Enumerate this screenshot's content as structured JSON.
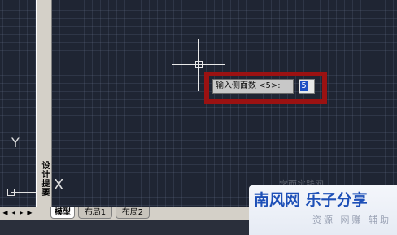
{
  "palette": {
    "title": "设计提要",
    "icon": "palette-menu-icon"
  },
  "prompt": {
    "text": "输入侧面数 <5>:",
    "value": "5"
  },
  "ucs": {
    "y_label": "Y",
    "x_label": "X"
  },
  "tabs": {
    "nav_first": "◀",
    "nav_prev": "◂",
    "nav_next": "▸",
    "nav_last": "▶",
    "items": [
      {
        "label": "模型",
        "active": true
      },
      {
        "label": "布局1",
        "active": false
      },
      {
        "label": "布局2",
        "active": false
      }
    ]
  },
  "watermark": {
    "main": "南风网 乐子分享",
    "sub": "资源 网赚 辅助",
    "faint": "学而实践网"
  },
  "colors": {
    "canvas": "#1f2533",
    "highlight": "#9b1212",
    "selection": "#1d4fc4",
    "brand": "#1d4fb7"
  }
}
